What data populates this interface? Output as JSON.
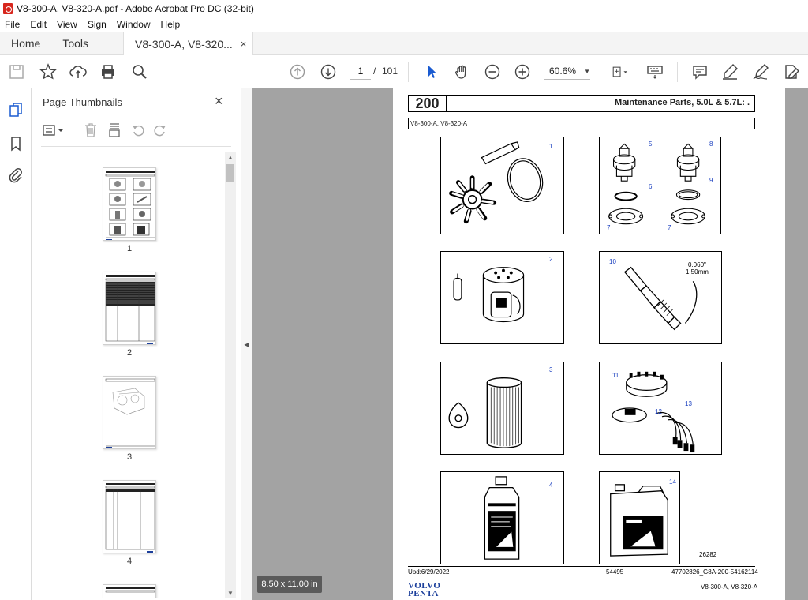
{
  "window": {
    "title": "V8-300-A, V8-320-A.pdf - Adobe Acrobat Pro DC (32-bit)"
  },
  "menu": [
    "File",
    "Edit",
    "View",
    "Sign",
    "Window",
    "Help"
  ],
  "tabs": {
    "home": "Home",
    "tools": "Tools",
    "doc": "V8-300-A, V8-320...",
    "close": "×"
  },
  "toolbar": {
    "page_current": "1",
    "page_separator": "/",
    "page_total": "101",
    "zoom": "60.6%",
    "icons": [
      "save-icon",
      "star-icon",
      "upload-icon",
      "print-icon",
      "search-icon",
      "page-up-icon",
      "page-down-icon",
      "select-arrow-icon",
      "hand-icon",
      "zoom-out-icon",
      "zoom-in-icon",
      "page-fit-icon",
      "keyboard-icon",
      "comment-icon",
      "highlight-icon",
      "sign-icon",
      "edit-pdf-icon"
    ]
  },
  "left_rail": {
    "icons": [
      "thumbnails-icon",
      "bookmark-icon",
      "attachment-icon"
    ]
  },
  "thumbnails_panel": {
    "title": "Page Thumbnails",
    "close": "×",
    "pages": [
      {
        "label": "1"
      },
      {
        "label": "2"
      },
      {
        "label": "3"
      },
      {
        "label": "4"
      }
    ]
  },
  "document": {
    "page_size": "8.50 x 11.00 in",
    "section_number": "200",
    "section_title": "Maintenance Parts, 5.0L & 5.7L: .",
    "models": "V8-300-A, V8-320-A",
    "callouts": [
      "1",
      "2",
      "3",
      "4",
      "5",
      "6",
      "7",
      "8",
      "9",
      "7",
      "10",
      "11",
      "12",
      "13",
      "14"
    ],
    "gap_label_line1": "0.060\"",
    "gap_label_line2": "1.50mm",
    "figure_number": "26282",
    "footer_updated": "Upd:6/29/2022",
    "footer_code": "54495",
    "footer_ref": "47702826_G8A-200-54162114",
    "footer_models": "V8-300-A, V8-320-A",
    "brand_line1": "VOLVO",
    "brand_line2": "PENTA"
  }
}
